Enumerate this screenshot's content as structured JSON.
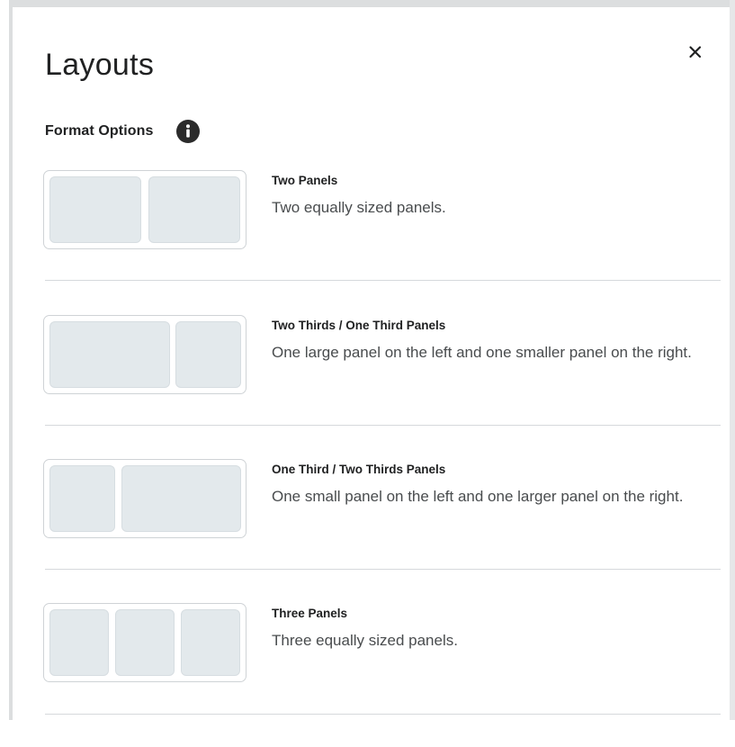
{
  "dialog": {
    "title": "Layouts",
    "close_icon": "close-icon",
    "format_label": "Format Options",
    "info_icon": "info-icon"
  },
  "options": [
    {
      "title": "Two Panels",
      "description": "Two equally sized panels.",
      "panels": 2
    },
    {
      "title": "Two Thirds / One Third Panels",
      "description": "One large panel on the left and one smaller panel on the right.",
      "panels": 2
    },
    {
      "title": "One Third / Two Thirds Panels",
      "description": "One small panel on the left and one larger panel on the right.",
      "panels": 2
    },
    {
      "title": "Three Panels",
      "description": "Three equally sized panels.",
      "panels": 3
    }
  ],
  "colors": {
    "panel_fill": "#e3e9ec",
    "thumb_border": "#cfd3d6",
    "divider": "#d6d9dc",
    "text": "#202122"
  }
}
